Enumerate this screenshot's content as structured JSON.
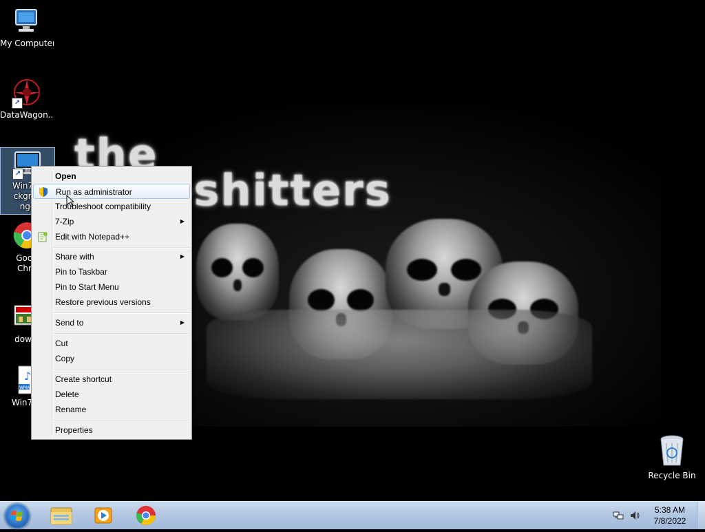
{
  "desktop": {
    "wallpaper_lines": [
      "the",
      "crapshitters"
    ],
    "icons": [
      {
        "label": "My Computer"
      },
      {
        "label": "DataWagon..."
      },
      {
        "label": "Win7Lo\nckgrou\nnge"
      },
      {
        "label": "Goog\nChro"
      },
      {
        "label": "downl"
      },
      {
        "label": "Win7Lo"
      }
    ],
    "recycle_bin_label": "Recycle Bin"
  },
  "context_menu": {
    "items": [
      {
        "label": "Open"
      },
      {
        "label": "Run as administrator"
      },
      {
        "label": "Troubleshoot compatibility"
      },
      {
        "label": "7-Zip"
      },
      {
        "label": "Edit with Notepad++"
      },
      {
        "label": "Share with"
      },
      {
        "label": "Pin to Taskbar"
      },
      {
        "label": "Pin to Start Menu"
      },
      {
        "label": "Restore previous versions"
      },
      {
        "label": "Send to"
      },
      {
        "label": "Cut"
      },
      {
        "label": "Copy"
      },
      {
        "label": "Create shortcut"
      },
      {
        "label": "Delete"
      },
      {
        "label": "Rename"
      },
      {
        "label": "Properties"
      }
    ],
    "submenu_arrow": "▶"
  },
  "taskbar": {
    "pinned": [
      "explorer-icon",
      "media-player-icon",
      "chrome-icon"
    ],
    "tray_icons": [
      "network-icon",
      "volume-icon"
    ],
    "clock_time": "5:38 AM",
    "clock_date": "7/8/2022"
  },
  "colors": {
    "menu_bg": "#f0f0f0",
    "highlight_border": "#a8c8ec",
    "taskbar": "#b3c8e2"
  }
}
